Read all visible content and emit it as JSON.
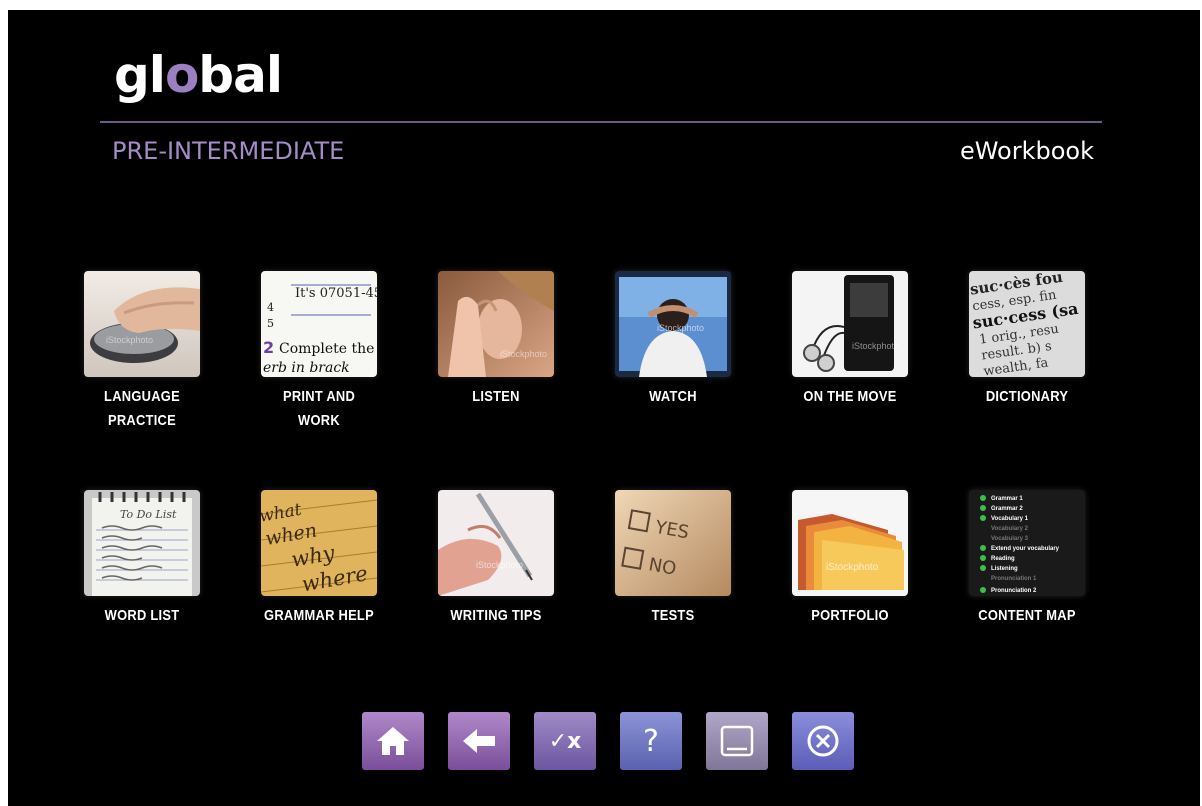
{
  "app": {
    "logo_text": "global",
    "level": "PRE-INTERMEDIATE",
    "product": "eWorkbook"
  },
  "tiles": [
    {
      "label": "LANGUAGE\nPRACTICE",
      "icon": "mouse-hand-photo"
    },
    {
      "label": "PRINT AND\nWORK",
      "icon": "worksheet-photo"
    },
    {
      "label": "LISTEN",
      "icon": "ear-photo"
    },
    {
      "label": "WATCH",
      "icon": "tv-viewer-photo"
    },
    {
      "label": "ON THE MOVE",
      "icon": "mp3-player-photo"
    },
    {
      "label": "DICTIONARY",
      "icon": "dictionary-photo"
    },
    {
      "label": "WORD LIST",
      "icon": "notepad-photo"
    },
    {
      "label": "GRAMMAR HELP",
      "icon": "words-photo"
    },
    {
      "label": "WRITING TIPS",
      "icon": "pen-hand-photo"
    },
    {
      "label": "TESTS",
      "icon": "yes-no-photo"
    },
    {
      "label": "PORTFOLIO",
      "icon": "folders-photo"
    },
    {
      "label": "CONTENT MAP",
      "icon": "content-map-thumbnail"
    }
  ],
  "content_map_preview": [
    "Grammar 1",
    "Grammar 2",
    "Vocabulary 1",
    "Vocabulary 2",
    "Vocabulary 3",
    "Extend your vocabulary",
    "Reading",
    "Listening",
    "Pronunciation 1",
    "Pronunciation 2"
  ],
  "thumb_texts": {
    "print": [
      "It's 07051-45",
      "Complete the",
      "erb in brack"
    ],
    "dictionary": [
      "suc·cès fou",
      "cess, esp. fin",
      "suc·cess (sa",
      "1 orig., resu",
      "result. b) s",
      "wealth, fa"
    ],
    "notepad": [
      "To Do List"
    ],
    "grammar": [
      "what",
      "when",
      "why",
      "where"
    ],
    "tests": [
      "YES",
      "NO"
    ],
    "watermark": "iStockphoto"
  },
  "nav_buttons": [
    {
      "name": "home-button",
      "icon": "home-icon",
      "glyph": "⌂"
    },
    {
      "name": "back-button",
      "icon": "back-arrow-icon",
      "glyph": "⬅"
    },
    {
      "name": "check-answers-button",
      "icon": "check-cross-icon",
      "glyph": "✓x"
    },
    {
      "name": "help-button",
      "icon": "question-icon",
      "glyph": "?"
    },
    {
      "name": "minimize-button",
      "icon": "minimize-icon",
      "glyph": ""
    },
    {
      "name": "close-button",
      "icon": "close-circle-icon",
      "glyph": "⊗"
    }
  ],
  "colors": {
    "background": "#000000",
    "accent": "#a58cc7",
    "rule": "#6d5a86"
  }
}
